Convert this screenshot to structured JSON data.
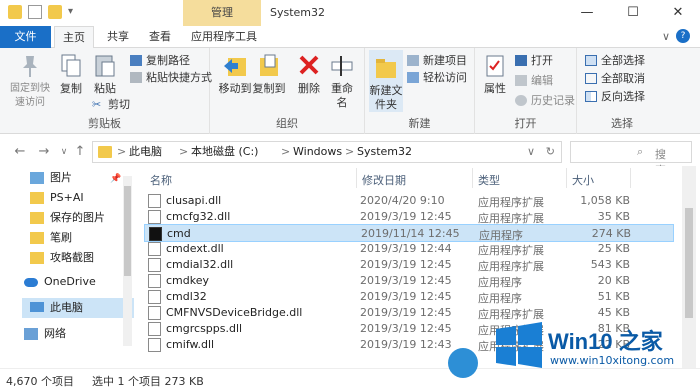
{
  "titlebar": {
    "context_tab": "管理",
    "title": "System32",
    "minimize": "—",
    "maximize": "☐",
    "close": "✕"
  },
  "tabs": {
    "file": "文件",
    "home": "主页",
    "share": "共享",
    "view": "查看",
    "apptools": "应用程序工具",
    "collapse": "∨",
    "help": "?"
  },
  "ribbon": {
    "clipboard": {
      "label": "剪贴板",
      "pin": "固定到快速访问",
      "copy": "复制",
      "paste": "粘贴",
      "cut": "剪切",
      "copy_path": "复制路径",
      "paste_shortcut": "粘贴快捷方式"
    },
    "organize": {
      "label": "组织",
      "move_to": "移动到",
      "copy_to": "复制到",
      "delete": "删除",
      "rename": "重命名"
    },
    "new": {
      "label": "新建",
      "new_folder": "新建文件夹",
      "new_item": "新建项目",
      "easy_access": "轻松访问"
    },
    "open": {
      "label": "打开",
      "properties": "属性",
      "open": "打开",
      "edit": "编辑",
      "history": "历史记录"
    },
    "select": {
      "label": "选择",
      "select_all": "全部选择",
      "select_none": "全部取消",
      "invert": "反向选择"
    }
  },
  "address": {
    "back": "←",
    "forward": "→",
    "up": "↑",
    "recent": "∨",
    "crumbs": [
      "此电脑",
      "本地磁盘 (C:)",
      "Windows",
      "System32"
    ],
    "separator": ">",
    "search_placeholder": "搜索\"Sy..."
  },
  "navpane": {
    "items": [
      "图片",
      "PS+AI",
      "保存的图片",
      "笔刷",
      "攻略截图",
      "OneDrive",
      "此电脑",
      "网络"
    ]
  },
  "columns": {
    "name": "名称",
    "date": "修改日期",
    "type": "类型",
    "size": "大小"
  },
  "files": [
    {
      "name": "clusapi.dll",
      "date": "2020/4/20 9:10",
      "type": "应用程序扩展",
      "size": "1,058 KB"
    },
    {
      "name": "cmcfg32.dll",
      "date": "2019/3/19 12:45",
      "type": "应用程序扩展",
      "size": "35 KB"
    },
    {
      "name": "cmd",
      "date": "2019/11/14 12:45",
      "type": "应用程序",
      "size": "274 KB"
    },
    {
      "name": "cmdext.dll",
      "date": "2019/3/19 12:44",
      "type": "应用程序扩展",
      "size": "25 KB"
    },
    {
      "name": "cmdial32.dll",
      "date": "2019/3/19 12:45",
      "type": "应用程序扩展",
      "size": "543 KB"
    },
    {
      "name": "cmdkey",
      "date": "2019/3/19 12:45",
      "type": "应用程序",
      "size": "20 KB"
    },
    {
      "name": "cmdl32",
      "date": "2019/3/19 12:45",
      "type": "应用程序",
      "size": "51 KB"
    },
    {
      "name": "CMFNVSDeviceBridge.dll",
      "date": "2019/3/19 12:45",
      "type": "应用程序扩展",
      "size": "45 KB"
    },
    {
      "name": "cmgrcspps.dll",
      "date": "2019/3/19 12:45",
      "type": "应用程序扩展",
      "size": "81 KB"
    },
    {
      "name": "cmifw.dll",
      "date": "2019/3/19 12:43",
      "type": "应用程序扩展",
      "size": "22 KB"
    }
  ],
  "status": {
    "count": "4,670 个项目",
    "selection": "选中 1 个项目  273 KB"
  },
  "watermark": {
    "title": "Win10 之家",
    "url": "www.win10xitong.com"
  }
}
